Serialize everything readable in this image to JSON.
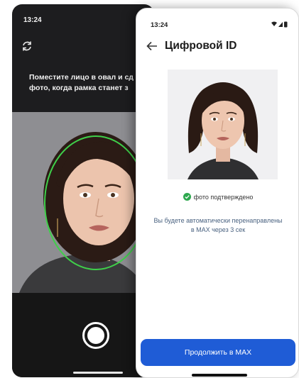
{
  "camera_screen": {
    "time": "13:24",
    "instruction": "Поместите лицо в овал и сд\nфото, когда рамка станет з",
    "icons": [
      "camera-switch-icon",
      "face-oval-guide",
      "shutter-button"
    ],
    "oval_color": "#3fcf4a"
  },
  "id_screen": {
    "time": "13:24",
    "status_icons": [
      "wifi-icon",
      "signal-icon",
      "battery-icon"
    ],
    "title": "Цифровой ID",
    "verified_text": "фото подтверждено",
    "redirect_text": "Вы будете автоматически перенаправлены\nв MAX через 3 сек",
    "continue_label": "Продолжить в MAX",
    "accent_color": "#1f5cd6",
    "check_color": "#2ea84f"
  }
}
